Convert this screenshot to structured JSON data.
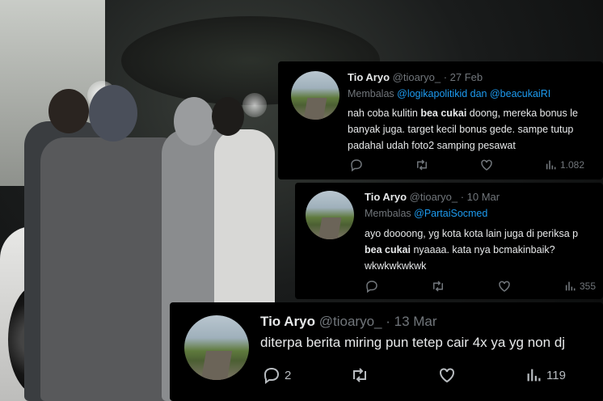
{
  "tweets": [
    {
      "name": "Tio Aryo",
      "handle": "@tioaryo_",
      "date": "· 27 Feb",
      "reply_prefix": "Membalas ",
      "reply_to": "@logikapolitikid dan @beacukaiRI",
      "lines": [
        {
          "pre": "nah coba kulitin ",
          "bold": "bea cukai",
          "post": " doong, mereka bonus le"
        },
        {
          "pre": "banyak juga. target kecil bonus gede. sampe tutup",
          "bold": "",
          "post": ""
        },
        {
          "pre": "padahal udah foto2 samping pesawat",
          "bold": "",
          "post": ""
        }
      ],
      "views": "1.082"
    },
    {
      "name": "Tio Aryo",
      "handle": "@tioaryo_",
      "date": "· 10 Mar",
      "reply_prefix": "Membalas ",
      "reply_to": "@PartaiSocmed",
      "lines": [
        {
          "pre": "ayo doooong, yg kota kota lain juga di periksa p",
          "bold": "",
          "post": ""
        },
        {
          "pre": "",
          "bold": "bea cukai",
          "post": " nyaaaa. kata nya bcmakinbaik?"
        },
        {
          "pre": "wkwkwkwkwk",
          "bold": "",
          "post": ""
        }
      ],
      "views": "355"
    },
    {
      "name": "Tio Aryo",
      "handle": "@tioaryo_",
      "date": "· 13 Mar",
      "lines": [
        {
          "pre": "diterpa berita miring pun tetep cair  4x ya yg non dj",
          "bold": "",
          "post": ""
        }
      ],
      "replies": "2",
      "views": "119"
    }
  ],
  "icons": {
    "reply": "reply-icon",
    "retweet": "retweet-icon",
    "like": "heart-icon",
    "views": "views-icon"
  },
  "colors": {
    "link": "#1d9bf0",
    "muted": "#71767b",
    "text": "#e7e9ea",
    "card": "#000000"
  }
}
